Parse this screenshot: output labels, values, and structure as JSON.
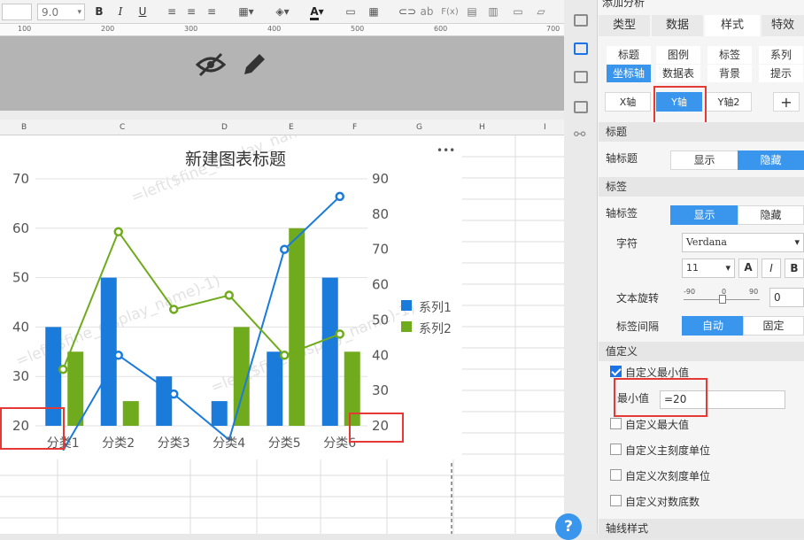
{
  "toolbar": {
    "font_size": "9.0",
    "bold": "B",
    "italic": "I",
    "underline": "U",
    "font_color_letter": "A",
    "format_ab": "ab",
    "fx": "F(x)"
  },
  "ruler": {
    "marks": [
      "100",
      "200",
      "300",
      "400",
      "500",
      "600",
      "700"
    ]
  },
  "columns": [
    "B",
    "C",
    "D",
    "E",
    "F",
    "G",
    "H",
    "I"
  ],
  "chart": {
    "title": "新建图表标题",
    "more": "•••",
    "left_ticks": [
      "70",
      "60",
      "50",
      "40",
      "30",
      "20"
    ],
    "right_ticks": [
      "90",
      "80",
      "70",
      "60",
      "50",
      "40",
      "30",
      "20"
    ],
    "legend": [
      "系列1",
      "系列2"
    ],
    "watermark": "=left($fine_display_name)-1)"
  },
  "chart_data": {
    "type": "bar",
    "categories": [
      "分类1",
      "分类2",
      "分类3",
      "分类4",
      "分类5",
      "分类6"
    ],
    "ylim": [
      20,
      70
    ],
    "y2lim": [
      20,
      90
    ],
    "series": [
      {
        "name": "系列1",
        "type": "bar",
        "values": [
          40,
          50,
          30,
          25,
          35,
          50
        ],
        "color": "#1a7bdb"
      },
      {
        "name": "系列2",
        "type": "bar",
        "values": [
          35,
          25,
          20,
          40,
          60,
          35
        ],
        "color": "#6fab1c"
      },
      {
        "name": "系列1",
        "type": "line",
        "axis": "right",
        "values": [
          13,
          40,
          29,
          16,
          70,
          85
        ],
        "color": "#1a7bdb"
      },
      {
        "name": "系列2",
        "type": "line",
        "axis": "right",
        "values": [
          36,
          75,
          53,
          57,
          40,
          46
        ],
        "color": "#6fab1c"
      }
    ]
  },
  "panel": {
    "header_partial": "添加分析",
    "tabs": [
      "类型",
      "数据",
      "样式",
      "特效"
    ],
    "active_tab": "样式",
    "subtabs_row1": [
      "标题",
      "图例",
      "标签",
      "系列"
    ],
    "subtabs_row2": [
      "坐标轴",
      "数据表",
      "背景",
      "提示"
    ],
    "active_subtab": "坐标轴",
    "axis_buttons": [
      "X轴",
      "Y轴",
      "Y轴2"
    ],
    "active_axis": "Y轴",
    "add_symbol": "+",
    "sec_title": "标题",
    "axis_title_label": "轴标题",
    "show": "显示",
    "hide": "隐藏",
    "sec_label": "标签",
    "axis_label_label": "轴标签",
    "font_label": "字符",
    "font_name": "Verdana",
    "font_size": "11",
    "rotate_label": "文本旋转",
    "rotate_min": "-90",
    "rotate_mid": "0",
    "rotate_max": "90",
    "rotate_value": "0",
    "label_gap": "标签间隔",
    "auto": "自动",
    "fixed": "固定",
    "sec_value": "值定义",
    "custom_min": "自定义最小值",
    "min_label": "最小值",
    "min_value": "=20",
    "custom_max": "自定义最大值",
    "custom_major": "自定义主刻度单位",
    "custom_minor": "自定义次刻度单位",
    "custom_log": "自定义对数底数",
    "sec_line": "轴线样式",
    "help": "?"
  },
  "colors": {
    "accent": "#3a96ec",
    "bar1": "#1a7bdb",
    "bar2": "#6fab1c",
    "highlight": "#e53935"
  }
}
